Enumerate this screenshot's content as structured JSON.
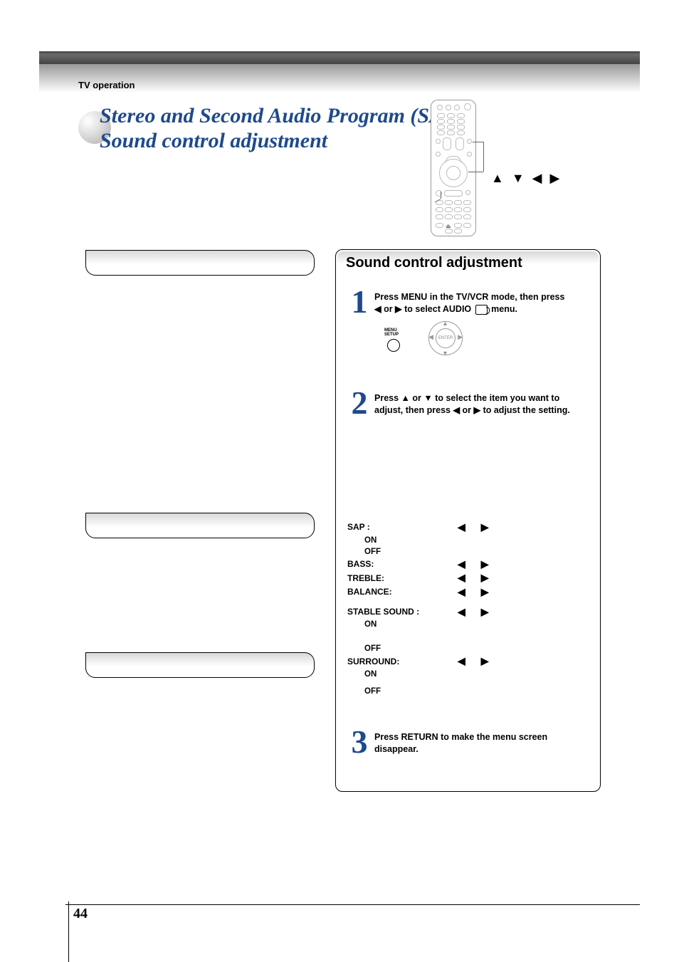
{
  "breadcrumb": "TV operation",
  "title_line1": "Stereo and Second Audio Program (SAP)/",
  "title_line2": "Sound control adjustment",
  "dpad_guide": "▲ ▼ ◀ ▶",
  "box_heading": "Sound control adjustment",
  "steps": {
    "s1": {
      "num": "1",
      "text_a": "Press MENU in the TV/VCR mode, then press",
      "text_b": "◀ or ▶ to select AUDIO",
      "text_c": "menu."
    },
    "s2": {
      "num": "2",
      "text_a": "Press ▲ or ▼ to select the item you want to",
      "text_b": "adjust, then press ◀ or ▶ to adjust the setting."
    },
    "s3": {
      "num": "3",
      "text_a": "Press RETURN to make the menu screen",
      "text_b": "disappear."
    }
  },
  "menu_setup_label_1": "MENU",
  "menu_setup_label_2": "SETUP",
  "dpad_enter": "ENTER",
  "settings": {
    "sap": {
      "label": "SAP :",
      "on": "ON",
      "off": "OFF"
    },
    "bass": "BASS:",
    "treble": "TREBLE:",
    "balance": "BALANCE:",
    "stable": {
      "label": "STABLE SOUND :",
      "on": "ON",
      "off": "OFF"
    },
    "surround": {
      "label": "SURROUND:",
      "on": "ON",
      "off": "OFF"
    }
  },
  "page_number": "44"
}
